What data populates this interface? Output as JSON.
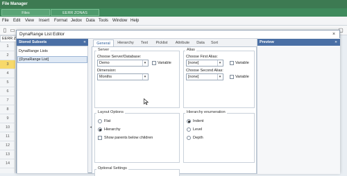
{
  "app": {
    "title": "File Manager"
  },
  "tabs": [
    {
      "label": "Files"
    },
    {
      "label": "EERR ZONAS"
    }
  ],
  "menu": [
    "File",
    "Edit",
    "View",
    "Insert",
    "Format",
    "Jedox",
    "Data",
    "Tools",
    "Window",
    "Help"
  ],
  "cell_ref": "EERR ZONA",
  "rows": [
    "1",
    "2",
    "3",
    "4",
    "5",
    "6",
    "7",
    "8",
    "9",
    "10",
    "11",
    "12",
    "13",
    "14"
  ],
  "dialog": {
    "title": "DynaRange List Editor",
    "close": "×",
    "stored_subsets": {
      "title": "Stored Subsets",
      "items": [
        "DynaRange Lists",
        "[DynaRange List]"
      ]
    },
    "tabs": [
      "General",
      "Hierarchy",
      "Text",
      "Picklist",
      "Attribute",
      "Data",
      "Sort"
    ],
    "server": {
      "label": "Server",
      "choose_label": "Choose Server/Database:",
      "choose_value": "Demo",
      "dimension_label": "Dimension:",
      "dimension_value": "Months",
      "variable_label": "Variable"
    },
    "alias": {
      "label": "Alias",
      "first_label": "Choose First Alias:",
      "first_value": "[none]",
      "second_label": "Choose Second Alias:",
      "second_value": "[none]",
      "variable_label_1": "Variable",
      "variable_label_2": "Variable"
    },
    "layout": {
      "label": "Layout Options",
      "flat": "Flat",
      "hierarchy": "Hierarchy",
      "show_parents": "Show parents below children",
      "selected": "Hierarchy"
    },
    "enumeration": {
      "label": "Hierarchy enumeration",
      "indent": "Indent",
      "level": "Level",
      "depth": "Depth",
      "selected": "Indent"
    },
    "optional": {
      "label": "Optional Settings"
    },
    "preview": {
      "title": "Preview"
    }
  }
}
